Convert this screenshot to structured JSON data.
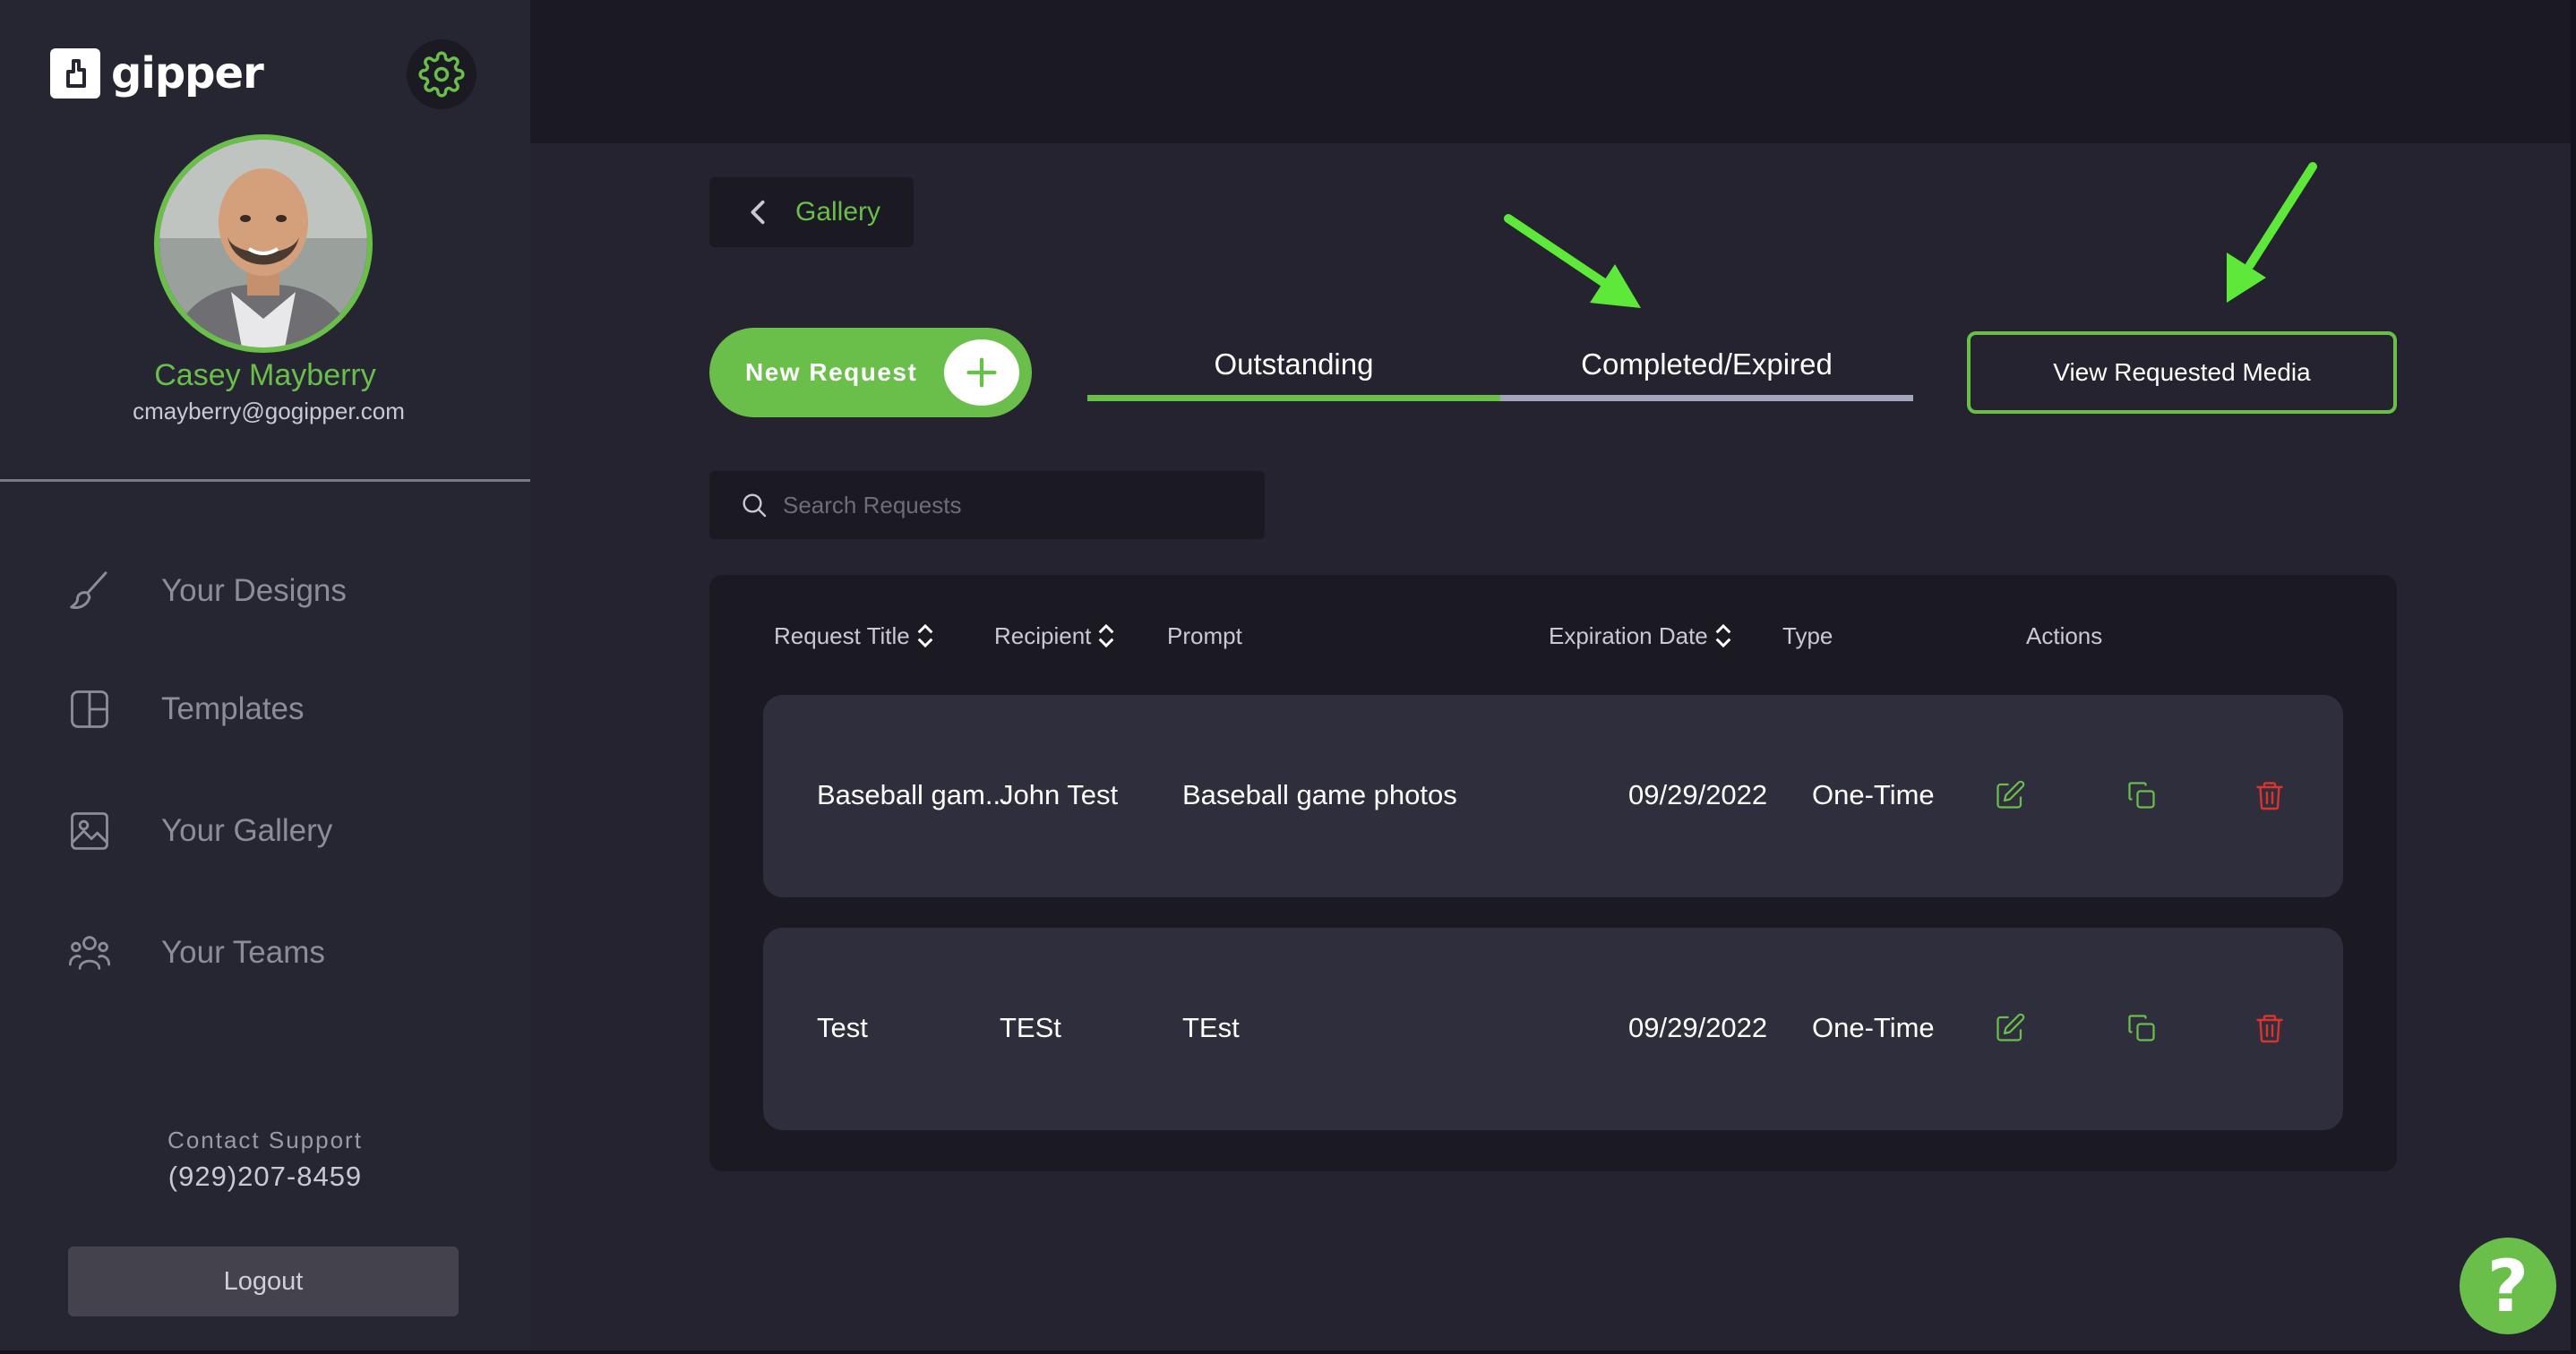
{
  "brand": {
    "name": "gipper"
  },
  "user": {
    "name": "Casey Mayberry",
    "email": "cmayberry@gogipper.com"
  },
  "sidebar": {
    "items": [
      {
        "label": "Your Designs",
        "icon": "paintbrush-icon"
      },
      {
        "label": "Templates",
        "icon": "layout-icon"
      },
      {
        "label": "Your Gallery",
        "icon": "image-icon"
      },
      {
        "label": "Your Teams",
        "icon": "users-icon"
      }
    ],
    "contact_label": "Contact Support",
    "contact_phone": "(929)207-8459",
    "logout_label": "Logout"
  },
  "back": {
    "label": "Gallery"
  },
  "new_request": {
    "label": "New Request"
  },
  "tabs": [
    {
      "label": "Outstanding",
      "active": true
    },
    {
      "label": "Completed/Expired",
      "active": false
    }
  ],
  "view_media": {
    "label": "View Requested Media"
  },
  "search": {
    "placeholder": "Search Requests"
  },
  "table": {
    "columns": [
      {
        "label": "Request Title",
        "sortable": true
      },
      {
        "label": "Recipient",
        "sortable": true
      },
      {
        "label": "Prompt",
        "sortable": false
      },
      {
        "label": "Expiration Date",
        "sortable": true
      },
      {
        "label": "Type",
        "sortable": false
      },
      {
        "label": "Actions",
        "sortable": false
      }
    ],
    "rows": [
      {
        "title": "Baseball gam...",
        "recipient": "John Test",
        "prompt": "Baseball game photos",
        "expiration": "09/29/2022",
        "type": "One-Time"
      },
      {
        "title": "Test",
        "recipient": "TESt",
        "prompt": "TEst",
        "expiration": "09/29/2022",
        "type": "One-Time"
      }
    ]
  },
  "help": {
    "label": "?"
  },
  "colors": {
    "accent": "#6abf4b",
    "background": "#24232f",
    "panel": "#1b1a23",
    "row": "#2f2e3c",
    "danger": "#d9352c",
    "tab_inactive": "#a3a5b8",
    "annotation_arrow": "#5ee83a"
  }
}
